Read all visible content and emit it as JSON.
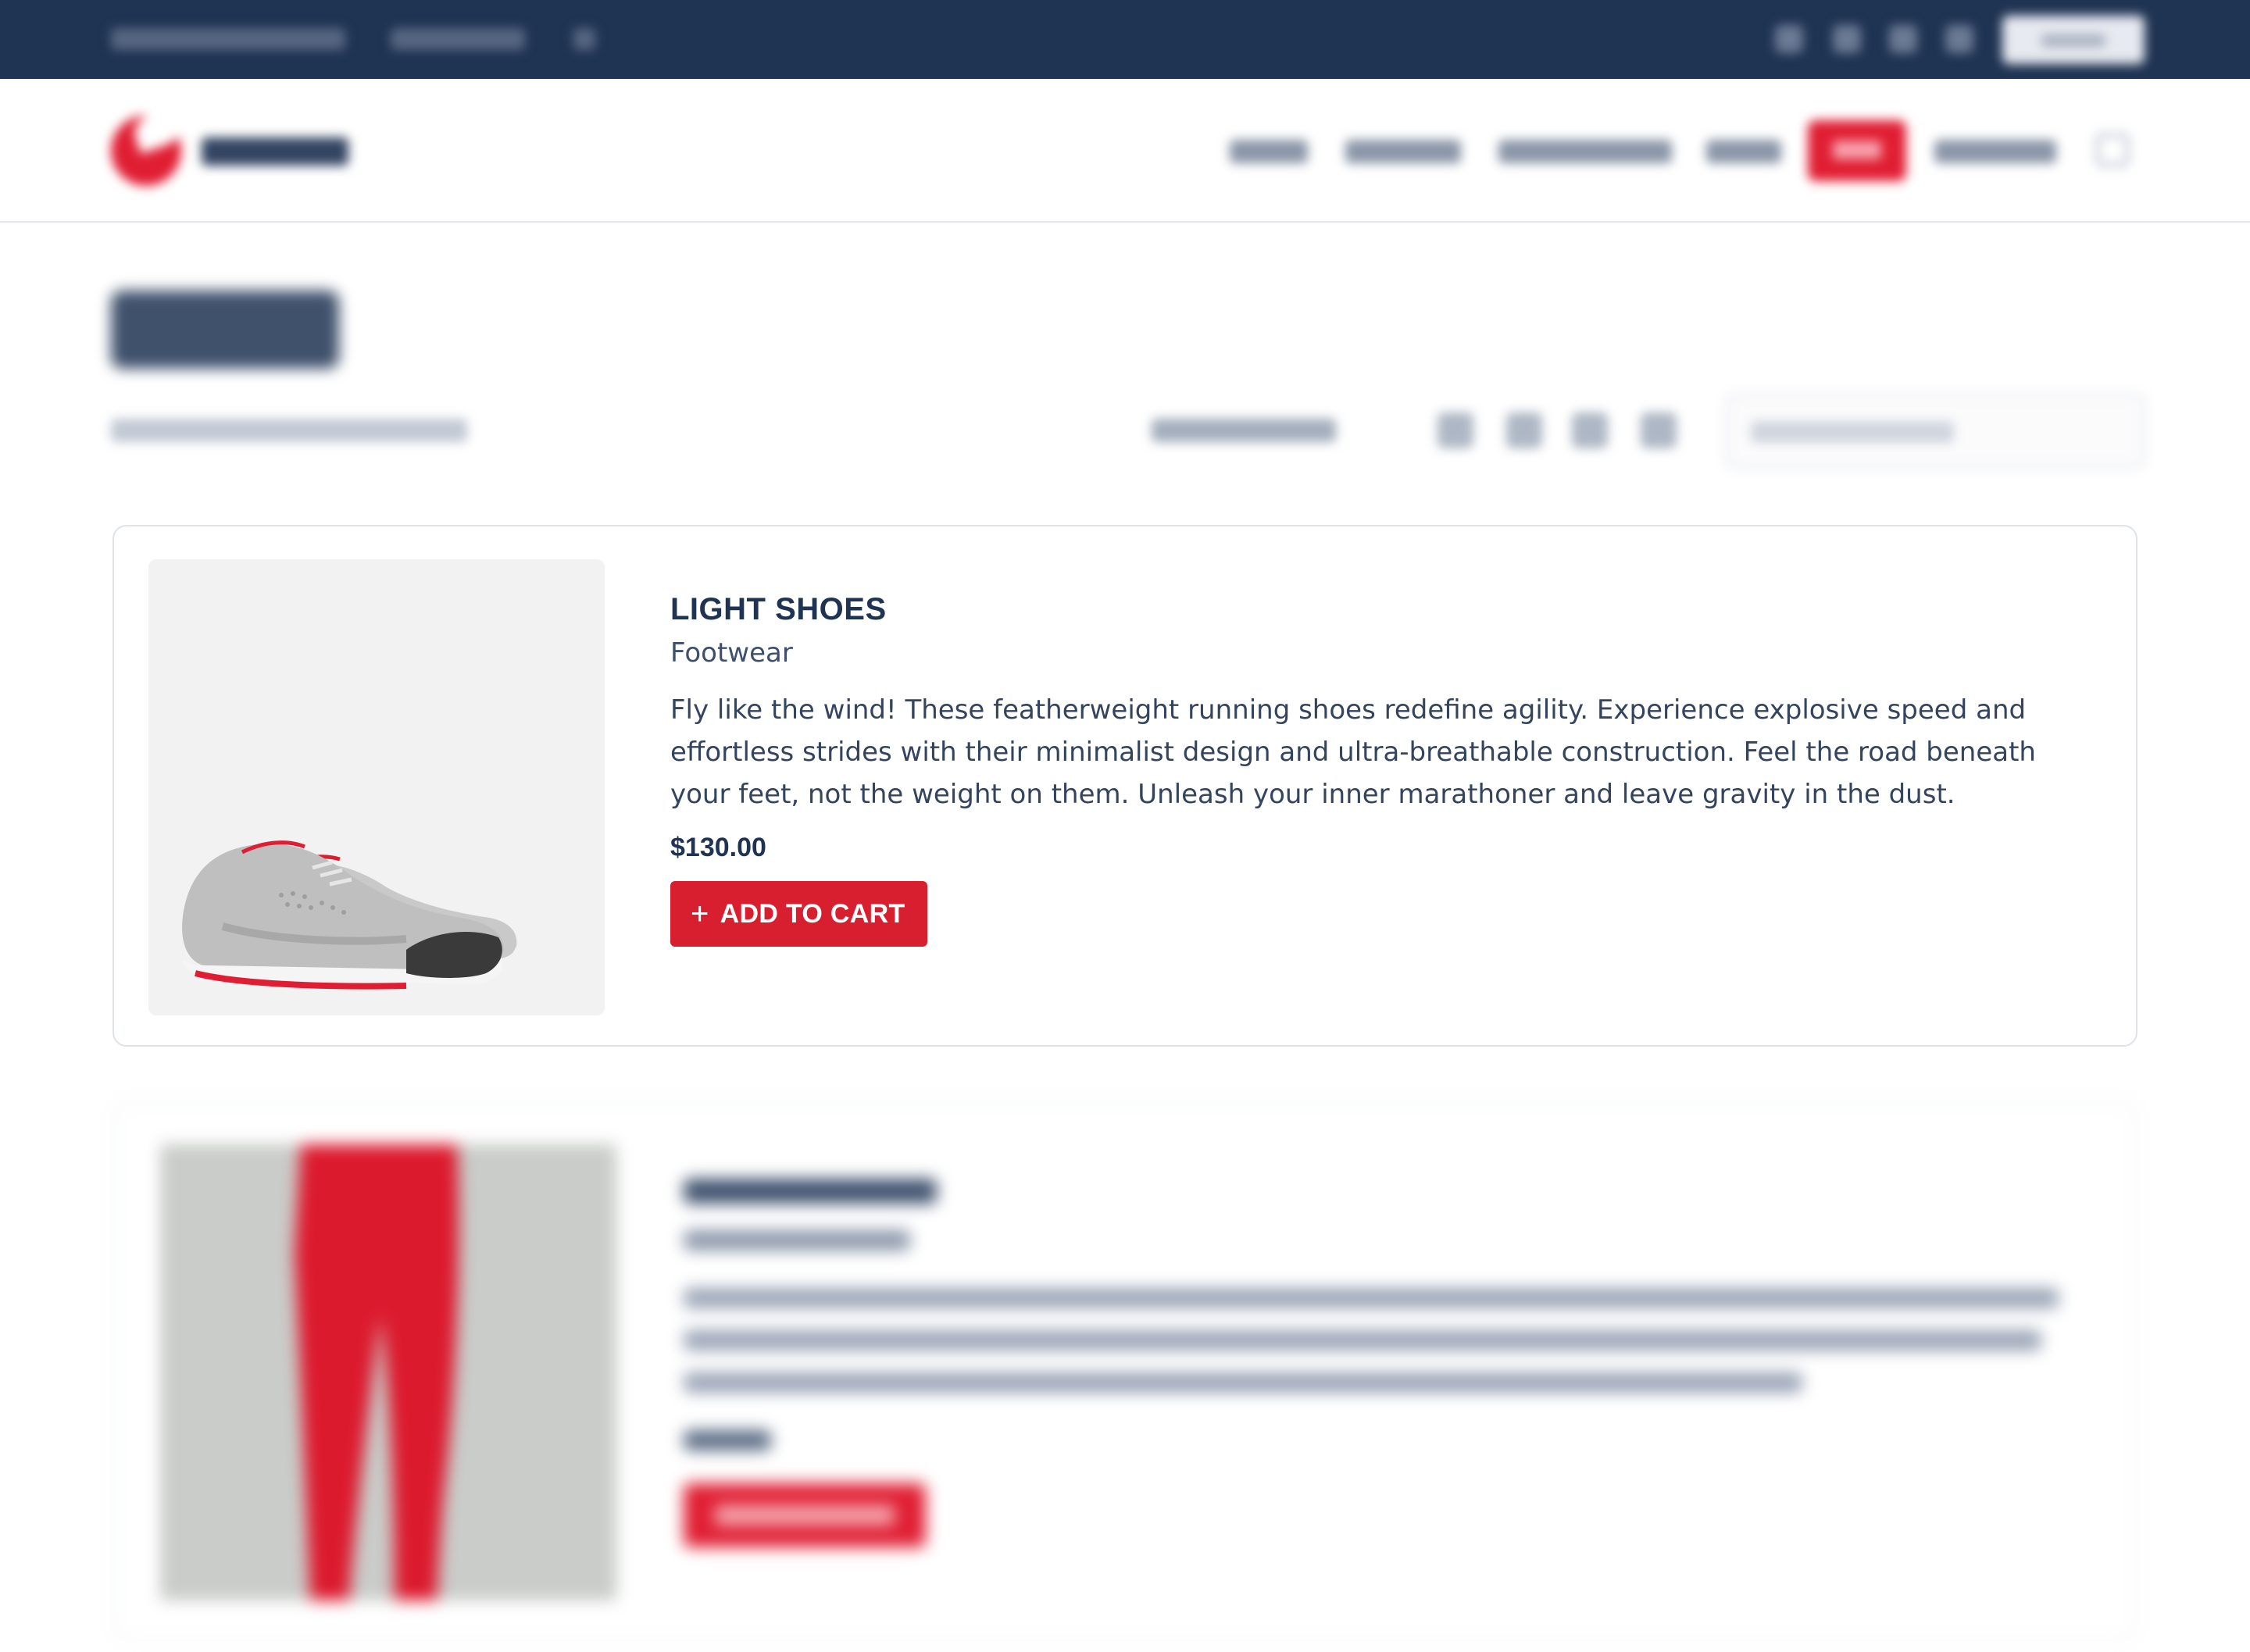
{
  "colors": {
    "navy": "#1f3352",
    "accent_red": "#d81f2f",
    "card_border": "#dfe3e8",
    "thumb_bg": "#f2f2f2"
  },
  "topbar": {
    "social_icons": [
      "social-icon-1",
      "social-icon-2",
      "social-icon-3",
      "social-icon-4"
    ]
  },
  "header": {
    "logo_icon": "brand-logo-icon",
    "nav_active_index": 4,
    "search_icon": "search-icon"
  },
  "toolbar": {
    "view_icons": [
      "grid-2-icon",
      "grid-3-icon",
      "grid-4-icon",
      "list-icon"
    ]
  },
  "products": [
    {
      "title": "LIGHT SHOES",
      "category": "Footwear",
      "description": "Fly like the wind! These featherweight running shoes redefine agility. Experience explosive speed and effortless strides with their minimalist design and ultra-breathable construction. Feel the road beneath your feet, not the weight on them. Unleash your inner marathoner and leave gravity in the dust.",
      "price": "$130.00",
      "button_label": "ADD TO CART",
      "button_icon": "plus-icon"
    }
  ]
}
